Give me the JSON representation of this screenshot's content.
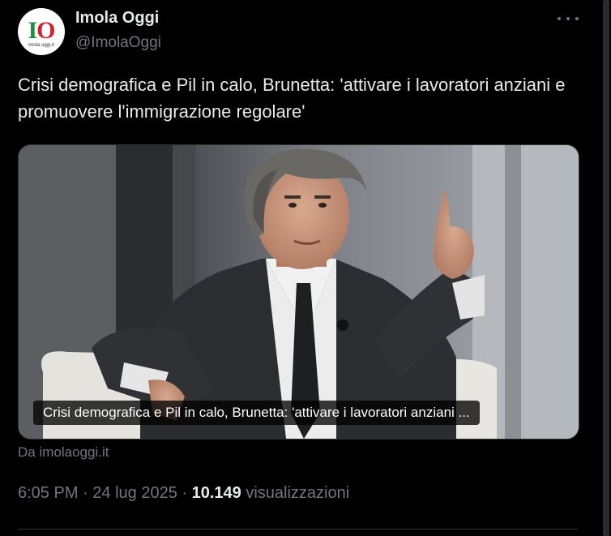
{
  "author": {
    "name": "Imola Oggi",
    "handle": "@ImolaOggi",
    "avatar_logo_i": "I",
    "avatar_logo_o": "O",
    "avatar_sub": "imola oggi.it"
  },
  "tweet": {
    "text": "Crisi demografica e Pil in calo, Brunetta: 'attivare i lavoratori anziani e promuovere l'immigrazione regolare'"
  },
  "card": {
    "caption": "Crisi demografica e Pil in calo, Brunetta: 'attivare i lavoratori anziani ...",
    "source": "Da imolaoggi.it"
  },
  "meta": {
    "time": "6:05 PM",
    "separator": "·",
    "date": "24 lug 2025",
    "views_count": "10.149",
    "views_label": "visualizzazioni"
  },
  "icons": {
    "more": "more-dots-icon"
  },
  "colors": {
    "background": "#000000",
    "text_primary": "#e7e9ea",
    "text_secondary": "#71767b",
    "border": "#2f3336",
    "logo_green": "#1a8f3c",
    "logo_red": "#d4202a"
  }
}
